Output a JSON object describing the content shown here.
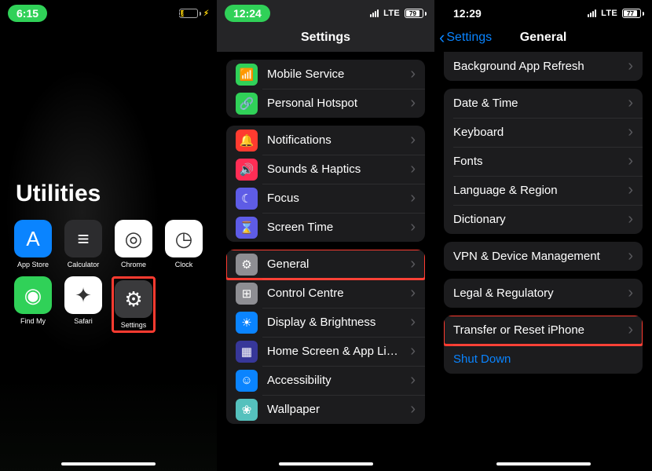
{
  "panel1": {
    "status": {
      "time": "6:15",
      "battery_pct": 18,
      "battery_text": "18"
    },
    "folder_title": "Utilities",
    "apps": [
      {
        "name": "App Store",
        "bg": "#0a84ff",
        "glyph": "A"
      },
      {
        "name": "Calculator",
        "bg": "#2c2c2e",
        "glyph": "≡"
      },
      {
        "name": "Chrome",
        "bg": "#ffffff",
        "glyph": "◎"
      },
      {
        "name": "Clock",
        "bg": "#ffffff",
        "glyph": "◷"
      },
      {
        "name": "Find My",
        "bg": "#30d158",
        "glyph": "◉"
      },
      {
        "name": "Safari",
        "bg": "#ffffff",
        "glyph": "✦"
      },
      {
        "name": "Settings",
        "bg": "#3a3a3c",
        "glyph": "⚙",
        "highlight": true
      }
    ]
  },
  "panel2": {
    "status": {
      "time": "12:24",
      "carrier": "LTE",
      "battery_text": "79"
    },
    "nav_title": "Settings",
    "group_a": [
      {
        "label": "Mobile Service",
        "icon": "📶",
        "bg": "#30d158"
      },
      {
        "label": "Personal Hotspot",
        "icon": "🔗",
        "bg": "#30d158"
      }
    ],
    "group_b": [
      {
        "label": "Notifications",
        "icon": "🔔",
        "bg": "#ff3b30"
      },
      {
        "label": "Sounds & Haptics",
        "icon": "🔊",
        "bg": "#ff2d55"
      },
      {
        "label": "Focus",
        "icon": "☾",
        "bg": "#5e5ce6"
      },
      {
        "label": "Screen Time",
        "icon": "⌛",
        "bg": "#5e5ce6"
      }
    ],
    "group_c": [
      {
        "label": "General",
        "icon": "⚙",
        "bg": "#8e8e93",
        "highlight": true
      },
      {
        "label": "Control Centre",
        "icon": "⊞",
        "bg": "#8e8e93"
      },
      {
        "label": "Display & Brightness",
        "icon": "☀",
        "bg": "#0a84ff"
      },
      {
        "label": "Home Screen & App Library",
        "icon": "▦",
        "bg": "#373799"
      },
      {
        "label": "Accessibility",
        "icon": "☺",
        "bg": "#0a84ff"
      },
      {
        "label": "Wallpaper",
        "icon": "❀",
        "bg": "#55c1bd"
      }
    ]
  },
  "panel3": {
    "status": {
      "time": "12:29",
      "carrier": "LTE",
      "battery_text": "77"
    },
    "nav_back": "Settings",
    "nav_title": "General",
    "group_a": [
      {
        "label": "Background App Refresh"
      }
    ],
    "group_b": [
      {
        "label": "Date & Time"
      },
      {
        "label": "Keyboard"
      },
      {
        "label": "Fonts"
      },
      {
        "label": "Language & Region"
      },
      {
        "label": "Dictionary"
      }
    ],
    "group_c": [
      {
        "label": "VPN & Device Management"
      }
    ],
    "group_d": [
      {
        "label": "Legal & Regulatory"
      }
    ],
    "group_e": [
      {
        "label": "Transfer or Reset iPhone",
        "highlight": true
      },
      {
        "label": "Shut Down",
        "blue": true,
        "no_chevron": true
      }
    ]
  }
}
